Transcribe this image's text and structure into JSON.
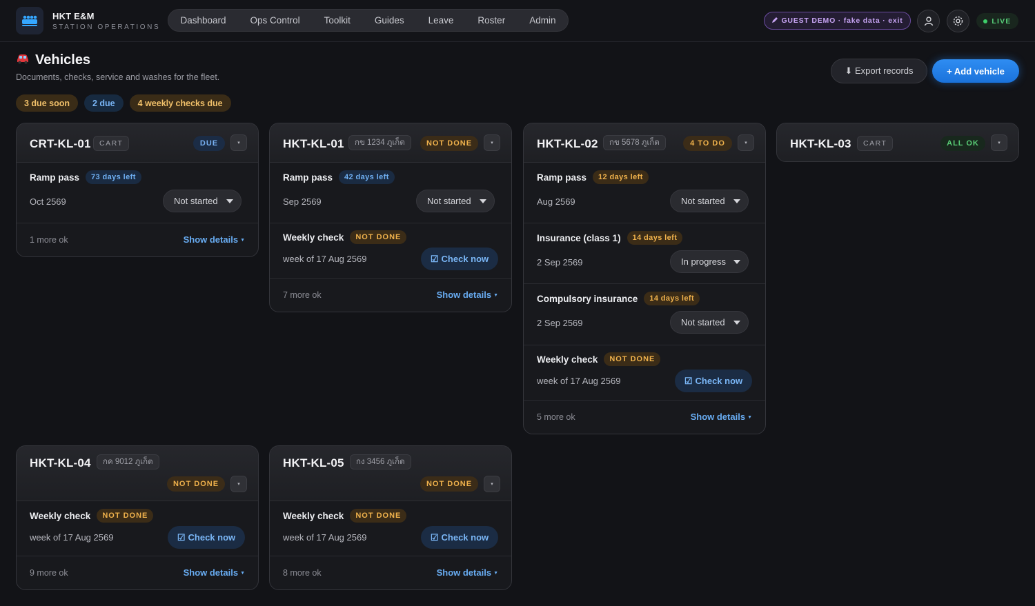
{
  "header": {
    "app_title": "HKT E&M",
    "app_subtitle": "STATION OPERATIONS",
    "nav": [
      "Dashboard",
      "Ops Control",
      "Toolkit",
      "Guides",
      "Leave",
      "Roster",
      "Admin"
    ],
    "guest_banner": "GUEST DEMO · fake data · exit",
    "live_label": "LIVE",
    "icons": [
      "bus-icon",
      "pencil-icon",
      "user-icon",
      "gear-icon",
      "live-dot-icon"
    ]
  },
  "page": {
    "title": "Vehicles",
    "subtitle": "Documents, checks, service and washes for the fleet.",
    "summary": [
      "3 due soon",
      "2 due",
      "4 weekly checks due"
    ],
    "export_label": "⬇ Export records",
    "add_label": "+ Add vehicle"
  },
  "common": {
    "check_now": "Check now",
    "show_details": "Show details"
  },
  "vehicles": [
    {
      "id": "CRT-KL-01",
      "tag": "CART",
      "status": "DUE",
      "items": [
        {
          "title": "Ramp pass",
          "badge": "73 days left",
          "date": "Oct 2569",
          "state": "Not started"
        }
      ],
      "footer": "1 more ok"
    },
    {
      "id": "HKT-KL-01",
      "tag": "กข 1234 ภูเก็ต",
      "status": "NOT DONE",
      "items": [
        {
          "title": "Ramp pass",
          "badge": "42 days left",
          "date": "Sep 2569",
          "state": "Not started"
        },
        {
          "title": "Weekly check",
          "badge": "NOT DONE",
          "date": "week of 17 Aug 2569"
        }
      ],
      "footer": "7 more ok"
    },
    {
      "id": "HKT-KL-02",
      "tag": "กข 5678 ภูเก็ต",
      "status": "4 TO DO",
      "items": [
        {
          "title": "Ramp pass",
          "badge": "12 days left",
          "date": "Aug 2569",
          "state": "Not started"
        },
        {
          "title": "Insurance (class 1)",
          "badge": "14 days left",
          "date": "2 Sep 2569",
          "state": "In progress"
        },
        {
          "title": "Compulsory insurance",
          "badge": "14 days left",
          "date": "2 Sep 2569",
          "state": "Not started"
        },
        {
          "title": "Weekly check",
          "badge": "NOT DONE",
          "date": "week of 17 Aug 2569"
        }
      ],
      "footer": "5 more ok"
    },
    {
      "id": "HKT-KL-03",
      "tag": "CART",
      "status": "ALL OK",
      "items": []
    },
    {
      "id": "HKT-KL-04",
      "tag": "กค 9012 ภูเก็ต",
      "status": "NOT DONE",
      "items": [
        {
          "title": "Weekly check",
          "badge": "NOT DONE",
          "date": "week of 17 Aug 2569"
        }
      ],
      "footer": "9 more ok"
    },
    {
      "id": "HKT-KL-05",
      "tag": "กง 3456 ภูเก็ต",
      "status": "NOT DONE",
      "items": [
        {
          "title": "Weekly check",
          "badge": "NOT DONE",
          "date": "week of 17 Aug 2569"
        }
      ],
      "footer": "8 more ok"
    }
  ]
}
